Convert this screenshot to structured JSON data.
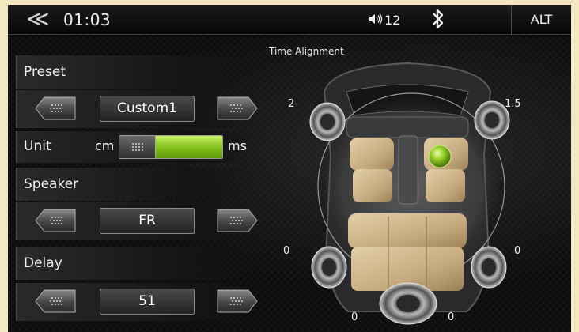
{
  "statusbar": {
    "back_icon": "double-chevron-left-icon",
    "back_glyph": "≪",
    "clock": "01:03",
    "volume_icon": "speaker-volume-icon",
    "volume": "12",
    "bluetooth_icon": "bluetooth-icon",
    "alt_label": "ALT"
  },
  "settings": {
    "preset": {
      "label": "Preset",
      "value": "Custom1"
    },
    "unit": {
      "label": "Unit",
      "left_option": "cm",
      "right_option": "ms",
      "selected": "ms"
    },
    "speaker": {
      "label": "Speaker",
      "value": "FR"
    },
    "delay": {
      "label": "Delay",
      "value": "51"
    }
  },
  "time_alignment": {
    "title": "Time Alignment",
    "front_left": "2",
    "front_right": "1.5",
    "rear_left": "0",
    "rear_right": "0",
    "sub_left": "0",
    "sub_right": "0",
    "selected_speaker": "FR"
  },
  "colors": {
    "accent_green": "#7fbf18",
    "seat_beige": "#c9b08a",
    "background": "#0c0c0c"
  }
}
